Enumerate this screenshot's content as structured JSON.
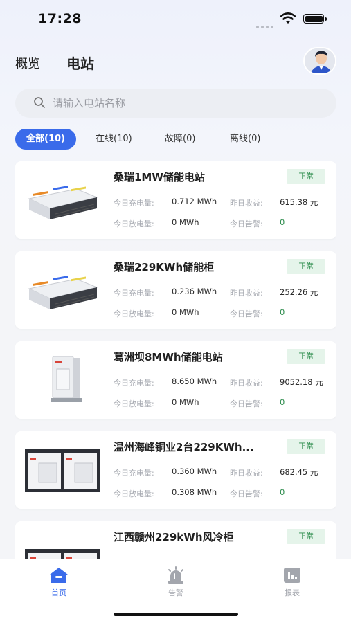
{
  "status_bar": {
    "time": "17:28"
  },
  "header": {
    "tabs": [
      {
        "label": "概览",
        "active": false
      },
      {
        "label": "电站",
        "active": true
      }
    ]
  },
  "search": {
    "placeholder": "请输入电站名称"
  },
  "filters": [
    {
      "label": "全部(10)",
      "active": true
    },
    {
      "label": "在线(10)",
      "active": false
    },
    {
      "label": "故障(0)",
      "active": false
    },
    {
      "label": "离线(0)",
      "active": false
    }
  ],
  "labels": {
    "charge_today": "今日充电量:",
    "discharge_today": "今日放电量:",
    "income_yesterday": "昨日收益:",
    "alarm_today": "今日告警:"
  },
  "stations": [
    {
      "name": "桑瑞1MW储能电站",
      "status": "正常",
      "charge": "0.712 MWh",
      "discharge": "0 MWh",
      "income": "615.38 元",
      "alarms": "0",
      "image": "battery-rack"
    },
    {
      "name": "桑瑞229KWh储能柜",
      "status": "正常",
      "charge": "0.236 MWh",
      "discharge": "0 MWh",
      "income": "252.26 元",
      "alarms": "0",
      "image": "battery-rack"
    },
    {
      "name": "葛洲坝8MWh储能电站",
      "status": "正常",
      "charge": "8.650 MWh",
      "discharge": "0 MWh",
      "income": "9052.18 元",
      "alarms": "0",
      "image": "cabinet"
    },
    {
      "name": "温州海峰铜业2台229KWh...",
      "status": "正常",
      "charge": "0.360 MWh",
      "discharge": "0.308 MWh",
      "income": "682.45 元",
      "alarms": "0",
      "image": "twin-cabinet"
    },
    {
      "name": "江西赣州229kWh风冷柜",
      "status": "正常",
      "charge": "",
      "discharge": "",
      "income": "",
      "alarms": "",
      "image": "twin-cabinet"
    }
  ],
  "tabbar": [
    {
      "label": "首页",
      "icon": "home-icon",
      "active": true
    },
    {
      "label": "告警",
      "icon": "alarm-icon",
      "active": false
    },
    {
      "label": "报表",
      "icon": "report-icon",
      "active": false
    }
  ],
  "colors": {
    "accent": "#3a6bea",
    "status_ok_bg": "#e5f4ea",
    "status_ok_text": "#2c8c4c"
  }
}
